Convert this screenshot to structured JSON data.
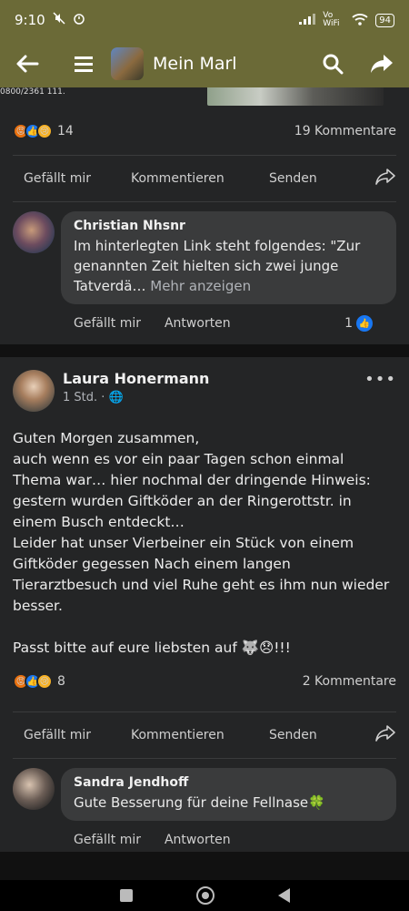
{
  "status": {
    "time": "9:10",
    "battery": "94",
    "network": "Vo WiFi"
  },
  "appbar": {
    "title": "Mein Marl"
  },
  "post1": {
    "snippet": "0800/2361 111.",
    "reaction_count": "14",
    "comment_count": "19 Kommentare",
    "actions": {
      "like": "Gefällt mir",
      "comment": "Kommentieren",
      "send": "Senden"
    },
    "comment": {
      "author": "Christian Nhsnr",
      "text": "Im hinterlegten Link steht folgendes: \"Zur genannten Zeit hielten sich zwei junge Tatverdä… ",
      "more": "Mehr anzeigen",
      "like": "Gefällt mir",
      "reply": "Antworten",
      "likes": "1"
    }
  },
  "post2": {
    "author": "Laura Honermann",
    "time": "1 Std. ·",
    "text": "Guten Morgen zusammen,\nauch wenn es vor ein paar Tagen schon einmal Thema war… hier nochmal der dringende Hinweis: gestern wurden Giftköder an der Ringerottstr. in einem Busch entdeckt…\nLeider hat unser Vierbeiner ein Stück von einem Giftköder gegessen Nach einem langen Tierarztbesuch und viel Ruhe geht es ihm nun wieder besser.\n\nPasst bitte auf eure liebsten auf 🐺😞!!!",
    "reaction_count": "8",
    "comment_count": "2 Kommentare",
    "actions": {
      "like": "Gefällt mir",
      "comment": "Kommentieren",
      "send": "Senden"
    },
    "comment": {
      "author": "Sandra Jendhoff",
      "text": "Gute Besserung für deine Fellnase🍀",
      "like": "Gefällt mir",
      "reply": "Antworten"
    }
  },
  "icons": {
    "back": "arrow-left-icon",
    "menu": "hamburger-icon",
    "search": "search-icon",
    "share": "share-icon",
    "more": "more-dots-icon",
    "globe": "globe-icon"
  },
  "colors": {
    "appbar": "#6b6a37",
    "background": "#242526",
    "like_blue": "#1877f2"
  }
}
